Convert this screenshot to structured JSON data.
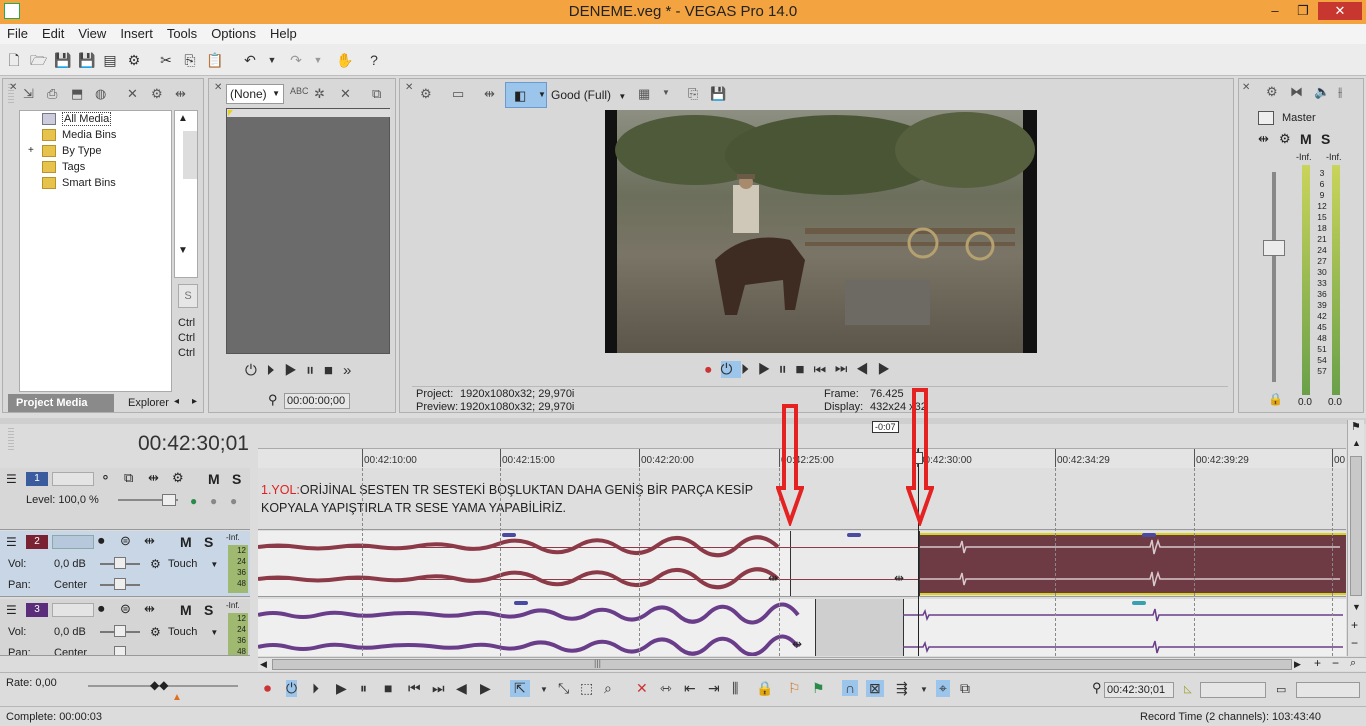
{
  "window": {
    "title": "DENEME.veg * - VEGAS Pro 14.0",
    "minimize": "‒",
    "maximize": "❐",
    "close": "✕"
  },
  "menu": [
    "File",
    "Edit",
    "View",
    "Insert",
    "Tools",
    "Options",
    "Help"
  ],
  "project_media": {
    "tree": [
      "All Media",
      "Media Bins",
      "By Type",
      "Tags",
      "Smart Bins"
    ],
    "expander": "+",
    "tabs": [
      "Project Media",
      "Explorer"
    ],
    "side_labels": [
      "Ctrl",
      "Ctrl",
      "Ctrl"
    ]
  },
  "trimmer": {
    "select_value": "(None)",
    "timecode": "00:00:00;00"
  },
  "preview": {
    "quality": "Good (Full)",
    "project_label": "Project:",
    "project_value": "1920x1080x32; 29,970i",
    "preview_label": "Preview:",
    "preview_value": "1920x1080x32; 29,970i",
    "frame_label": "Frame:",
    "frame_value": "76.425",
    "display_label": "Display:",
    "display_value": "432x24 x32"
  },
  "master": {
    "title": "Master",
    "m": "M",
    "s": "S",
    "inf_left": "-Inf.",
    "inf_right": "-Inf.",
    "scale": [
      "3",
      "6",
      "9",
      "12",
      "15",
      "18",
      "21",
      "24",
      "27",
      "30",
      "33",
      "36",
      "39",
      "42",
      "45",
      "48",
      "51",
      "54",
      "57"
    ],
    "bottom_left": "0.0",
    "bottom_right": "0.0"
  },
  "timeline": {
    "timecode": "00:42:30;01",
    "ruler": [
      "00:42:10:00",
      "00:42:15:00",
      "00:42:20:00",
      "00:42:25:00",
      "00:42:30:00",
      "00:42:34:29",
      "00:42:39:29",
      "00"
    ],
    "cursor_offset": "-0:07",
    "annotation_line1_prefix": "1.YOL:",
    "annotation_line1": "ORİJİNAL SESTEN TR SESTEKİ BOŞLUKTAN DAHA GENİŞ BİR PARÇA KESİP",
    "annotation_line2": "KOPYALA YAPIŞTIRLA TR SESE YAMA YAPABİLİRİZ.",
    "tracks": [
      {
        "number": "1",
        "level_label": "Level:",
        "level_value": "100,0 %",
        "m": "M",
        "s": "S"
      },
      {
        "number": "2",
        "vol_label": "Vol:",
        "vol_value": "0,0 dB",
        "pan_label": "Pan:",
        "pan_value": "Center",
        "mode": "Touch",
        "m": "M",
        "s": "S",
        "inf": "-Inf.",
        "meter": [
          "12",
          "24",
          "36",
          "48"
        ]
      },
      {
        "number": "3",
        "vol_label": "Vol:",
        "vol_value": "0,0 dB",
        "pan_label": "Pan:",
        "pan_value": "Center",
        "mode": "Touch",
        "m": "M",
        "s": "S",
        "inf": "-Inf.",
        "meter": [
          "12",
          "24",
          "36",
          "48"
        ]
      }
    ],
    "rate": "Rate: 0,00",
    "bottom_timecode": "00:42:30;01"
  },
  "status": {
    "complete": "Complete: 00:00:03",
    "record_time": "Record Time (2 channels): 103:43:40"
  },
  "colors": {
    "titlebar": "#f3a33f",
    "track2_clip": "#6e3a44",
    "track2_selected_border": "#d8d220",
    "track3_wave": "#6a3d8a",
    "track2_wave": "#8c3a48",
    "annotation_red": "#e02020",
    "arrow_red": "#e52222"
  }
}
